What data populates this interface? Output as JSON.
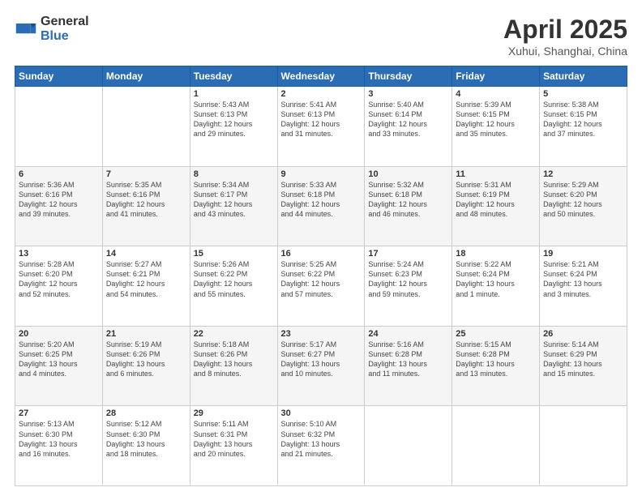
{
  "header": {
    "logo_general": "General",
    "logo_blue": "Blue",
    "month_title": "April 2025",
    "location": "Xuhui, Shanghai, China"
  },
  "weekdays": [
    "Sunday",
    "Monday",
    "Tuesday",
    "Wednesday",
    "Thursday",
    "Friday",
    "Saturday"
  ],
  "weeks": [
    [
      {
        "day": "",
        "info": ""
      },
      {
        "day": "",
        "info": ""
      },
      {
        "day": "1",
        "info": "Sunrise: 5:43 AM\nSunset: 6:13 PM\nDaylight: 12 hours\nand 29 minutes."
      },
      {
        "day": "2",
        "info": "Sunrise: 5:41 AM\nSunset: 6:13 PM\nDaylight: 12 hours\nand 31 minutes."
      },
      {
        "day": "3",
        "info": "Sunrise: 5:40 AM\nSunset: 6:14 PM\nDaylight: 12 hours\nand 33 minutes."
      },
      {
        "day": "4",
        "info": "Sunrise: 5:39 AM\nSunset: 6:15 PM\nDaylight: 12 hours\nand 35 minutes."
      },
      {
        "day": "5",
        "info": "Sunrise: 5:38 AM\nSunset: 6:15 PM\nDaylight: 12 hours\nand 37 minutes."
      }
    ],
    [
      {
        "day": "6",
        "info": "Sunrise: 5:36 AM\nSunset: 6:16 PM\nDaylight: 12 hours\nand 39 minutes."
      },
      {
        "day": "7",
        "info": "Sunrise: 5:35 AM\nSunset: 6:16 PM\nDaylight: 12 hours\nand 41 minutes."
      },
      {
        "day": "8",
        "info": "Sunrise: 5:34 AM\nSunset: 6:17 PM\nDaylight: 12 hours\nand 43 minutes."
      },
      {
        "day": "9",
        "info": "Sunrise: 5:33 AM\nSunset: 6:18 PM\nDaylight: 12 hours\nand 44 minutes."
      },
      {
        "day": "10",
        "info": "Sunrise: 5:32 AM\nSunset: 6:18 PM\nDaylight: 12 hours\nand 46 minutes."
      },
      {
        "day": "11",
        "info": "Sunrise: 5:31 AM\nSunset: 6:19 PM\nDaylight: 12 hours\nand 48 minutes."
      },
      {
        "day": "12",
        "info": "Sunrise: 5:29 AM\nSunset: 6:20 PM\nDaylight: 12 hours\nand 50 minutes."
      }
    ],
    [
      {
        "day": "13",
        "info": "Sunrise: 5:28 AM\nSunset: 6:20 PM\nDaylight: 12 hours\nand 52 minutes."
      },
      {
        "day": "14",
        "info": "Sunrise: 5:27 AM\nSunset: 6:21 PM\nDaylight: 12 hours\nand 54 minutes."
      },
      {
        "day": "15",
        "info": "Sunrise: 5:26 AM\nSunset: 6:22 PM\nDaylight: 12 hours\nand 55 minutes."
      },
      {
        "day": "16",
        "info": "Sunrise: 5:25 AM\nSunset: 6:22 PM\nDaylight: 12 hours\nand 57 minutes."
      },
      {
        "day": "17",
        "info": "Sunrise: 5:24 AM\nSunset: 6:23 PM\nDaylight: 12 hours\nand 59 minutes."
      },
      {
        "day": "18",
        "info": "Sunrise: 5:22 AM\nSunset: 6:24 PM\nDaylight: 13 hours\nand 1 minute."
      },
      {
        "day": "19",
        "info": "Sunrise: 5:21 AM\nSunset: 6:24 PM\nDaylight: 13 hours\nand 3 minutes."
      }
    ],
    [
      {
        "day": "20",
        "info": "Sunrise: 5:20 AM\nSunset: 6:25 PM\nDaylight: 13 hours\nand 4 minutes."
      },
      {
        "day": "21",
        "info": "Sunrise: 5:19 AM\nSunset: 6:26 PM\nDaylight: 13 hours\nand 6 minutes."
      },
      {
        "day": "22",
        "info": "Sunrise: 5:18 AM\nSunset: 6:26 PM\nDaylight: 13 hours\nand 8 minutes."
      },
      {
        "day": "23",
        "info": "Sunrise: 5:17 AM\nSunset: 6:27 PM\nDaylight: 13 hours\nand 10 minutes."
      },
      {
        "day": "24",
        "info": "Sunrise: 5:16 AM\nSunset: 6:28 PM\nDaylight: 13 hours\nand 11 minutes."
      },
      {
        "day": "25",
        "info": "Sunrise: 5:15 AM\nSunset: 6:28 PM\nDaylight: 13 hours\nand 13 minutes."
      },
      {
        "day": "26",
        "info": "Sunrise: 5:14 AM\nSunset: 6:29 PM\nDaylight: 13 hours\nand 15 minutes."
      }
    ],
    [
      {
        "day": "27",
        "info": "Sunrise: 5:13 AM\nSunset: 6:30 PM\nDaylight: 13 hours\nand 16 minutes."
      },
      {
        "day": "28",
        "info": "Sunrise: 5:12 AM\nSunset: 6:30 PM\nDaylight: 13 hours\nand 18 minutes."
      },
      {
        "day": "29",
        "info": "Sunrise: 5:11 AM\nSunset: 6:31 PM\nDaylight: 13 hours\nand 20 minutes."
      },
      {
        "day": "30",
        "info": "Sunrise: 5:10 AM\nSunset: 6:32 PM\nDaylight: 13 hours\nand 21 minutes."
      },
      {
        "day": "",
        "info": ""
      },
      {
        "day": "",
        "info": ""
      },
      {
        "day": "",
        "info": ""
      }
    ]
  ]
}
